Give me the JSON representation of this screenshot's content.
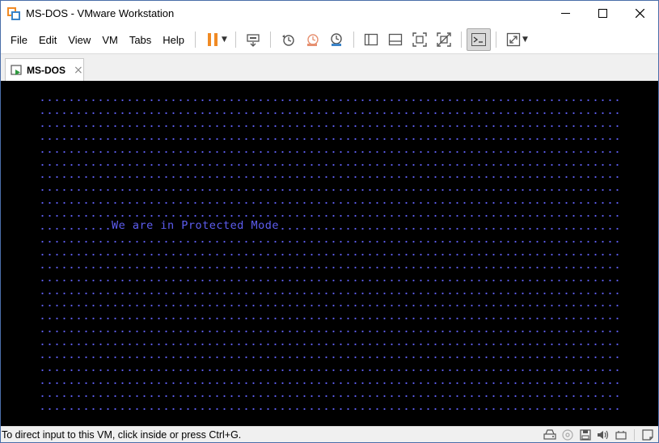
{
  "window": {
    "title": "MS-DOS - VMware Workstation"
  },
  "menu": {
    "items": [
      {
        "label": "File"
      },
      {
        "label": "Edit"
      },
      {
        "label": "View"
      },
      {
        "label": "VM"
      },
      {
        "label": "Tabs"
      },
      {
        "label": "Help"
      }
    ]
  },
  "tabs": [
    {
      "label": "MS-DOS",
      "close": "×"
    }
  ],
  "console": {
    "message": "We are in Protected Mode",
    "text_color": "#5d5df0",
    "background": "#000000"
  },
  "statusbar": {
    "text": "To direct input to this VM, click inside or press Ctrl+G."
  },
  "colors": {
    "accent_orange": "#f08a24",
    "accent_blue": "#3a83c8"
  }
}
